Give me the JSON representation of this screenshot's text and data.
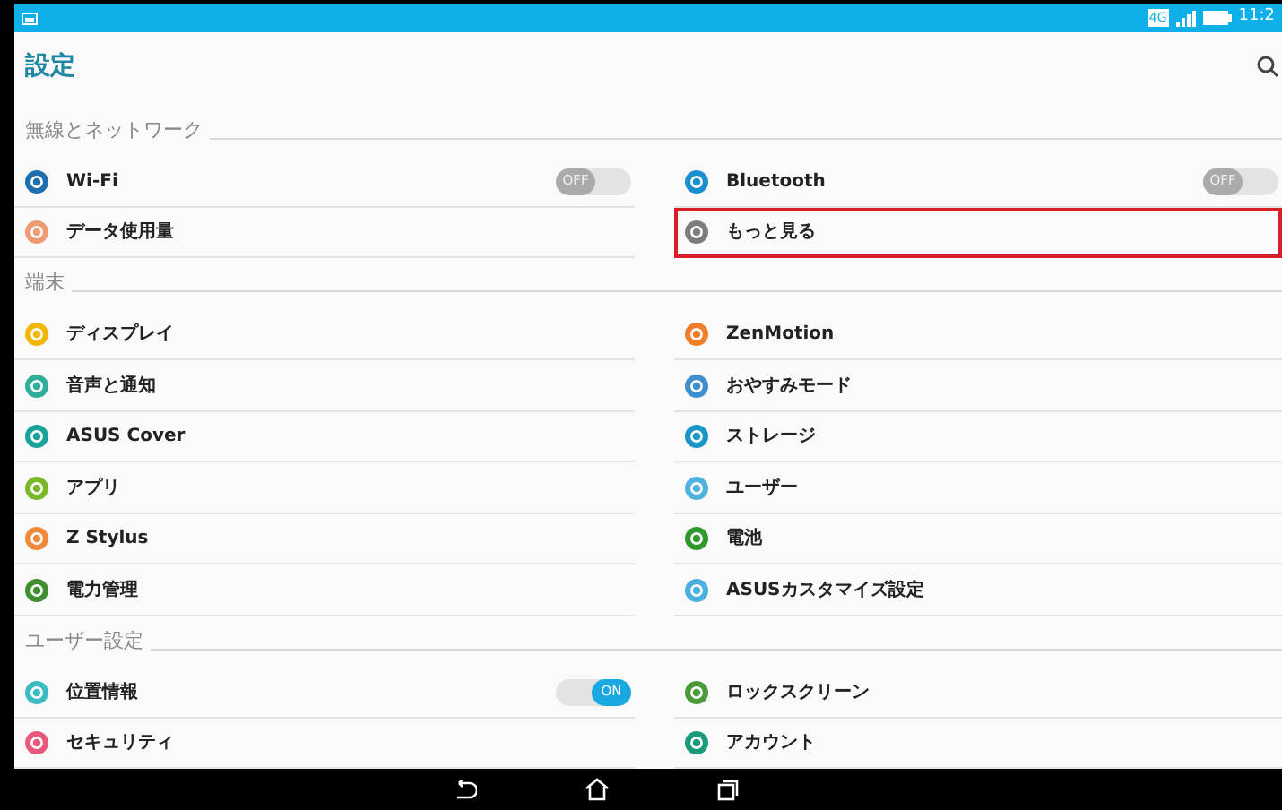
{
  "status_bar": {
    "network": "4G",
    "time": "11:2"
  },
  "title_bar": {
    "title": "設定"
  },
  "sections": [
    {
      "title": "無線とネットワーク",
      "items": [
        {
          "label": "Wi-Fi",
          "color": "#1e6fb0",
          "kind": "toggle",
          "on": false,
          "toggle_text": "OFF",
          "highlighted": false
        },
        {
          "label": "Bluetooth",
          "color": "#1a8fd0",
          "kind": "toggle",
          "on": false,
          "toggle_text": "OFF",
          "highlighted": false
        },
        {
          "label": "データ使用量",
          "color": "#ef9a70",
          "kind": "link",
          "highlighted": false
        },
        {
          "label": "もっと見る",
          "color": "#7a7f7a",
          "kind": "link",
          "highlighted": true
        }
      ]
    },
    {
      "title": "端末",
      "items": [
        {
          "label": "ディスプレイ",
          "color": "#f2b705",
          "kind": "link",
          "highlighted": false
        },
        {
          "label": "ZenMotion",
          "color": "#f07e2a",
          "kind": "link",
          "highlighted": false
        },
        {
          "label": "音声と通知",
          "color": "#2fae9a",
          "kind": "link",
          "highlighted": false
        },
        {
          "label": "おやすみモード",
          "color": "#3f8fd0",
          "kind": "link",
          "highlighted": false
        },
        {
          "label": "ASUS Cover",
          "color": "#1aa39a",
          "kind": "link",
          "highlighted": false
        },
        {
          "label": "ストレージ",
          "color": "#1896c8",
          "kind": "link",
          "highlighted": false
        },
        {
          "label": "アプリ",
          "color": "#7ab829",
          "kind": "link",
          "highlighted": false
        },
        {
          "label": "ユーザー",
          "color": "#4fb3e0",
          "kind": "link",
          "highlighted": false
        },
        {
          "label": "Z Stylus",
          "color": "#f08a3a",
          "kind": "link",
          "highlighted": false
        },
        {
          "label": "電池",
          "color": "#2e9a2e",
          "kind": "link",
          "highlighted": false
        },
        {
          "label": "電力管理",
          "color": "#3f8f2f",
          "kind": "link",
          "highlighted": false
        },
        {
          "label": "ASUSカスタマイズ設定",
          "color": "#4ab0e0",
          "kind": "link",
          "highlighted": false
        }
      ]
    },
    {
      "title": "ユーザー設定",
      "items": [
        {
          "label": "位置情報",
          "color": "#3cbcc0",
          "kind": "toggle",
          "on": true,
          "toggle_text": "ON",
          "highlighted": false
        },
        {
          "label": "ロックスクリーン",
          "color": "#4a9a3a",
          "kind": "link",
          "highlighted": false
        },
        {
          "label": "セキュリティ",
          "color": "#e8587a",
          "kind": "link",
          "highlighted": false
        },
        {
          "label": "アカウント",
          "color": "#1a9a7a",
          "kind": "link",
          "highlighted": false
        }
      ]
    }
  ]
}
